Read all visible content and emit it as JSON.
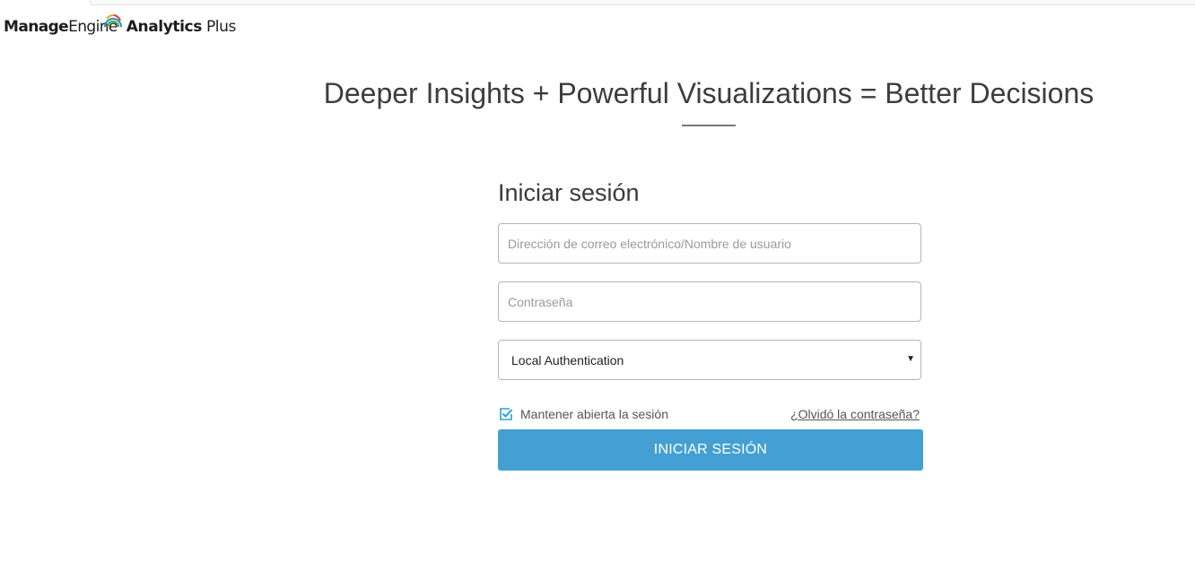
{
  "header": {
    "brand_regular": "Manage",
    "brand_engine": "Engine",
    "product_bold": "Analytics",
    "product_regular": "Plus"
  },
  "headline": "Deeper Insights + Powerful Visualizations = Better Decisions",
  "login": {
    "title": "Iniciar sesión",
    "email_placeholder": "Dirección de correo electrónico/Nombre de usuario",
    "email_value": "",
    "password_placeholder": "Contraseña",
    "password_value": "",
    "auth_select_value": "Local Authentication",
    "keep_signed_in_label": "Mantener abierta la sesión",
    "keep_signed_in_checked": true,
    "forgot_password_link": "¿Olvidó la contraseña?",
    "submit_label": "INICIAR SESIÓN"
  },
  "icons": {
    "logo_arc": "logo-arc-icon",
    "checkbox": "checkbox-checked-icon",
    "dropdown": "caret-down-icon"
  },
  "colors": {
    "button_bg": "#44a0d4",
    "checkbox_accent": "#2aa0d8",
    "logo_arc_colors": [
      "#e4322b",
      "#f2a31b",
      "#3aa935",
      "#1f8fd1"
    ]
  }
}
